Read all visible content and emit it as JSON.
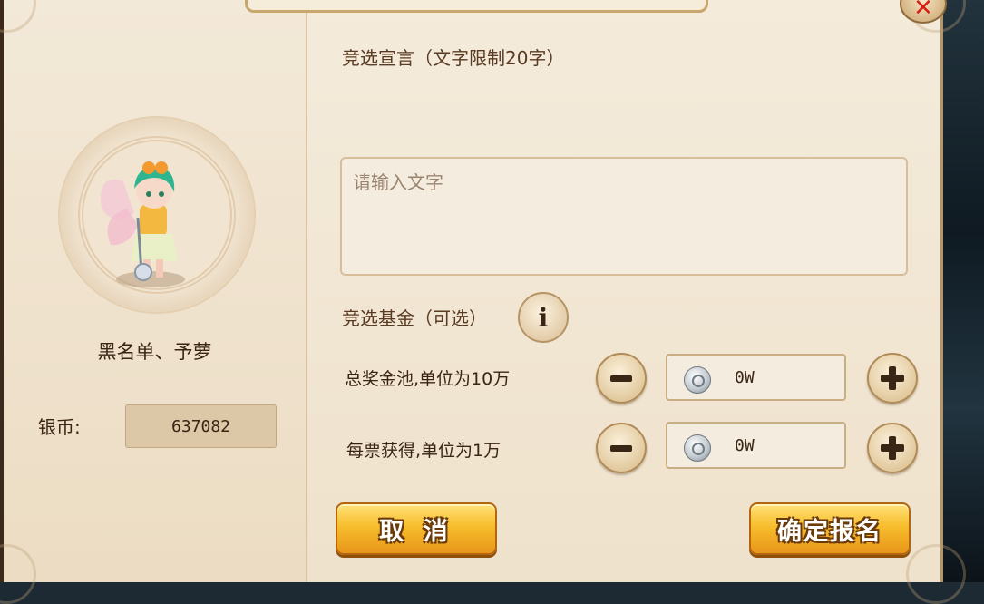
{
  "dialog": {
    "close_symbol": "✕",
    "close_icon": "close-icon"
  },
  "player": {
    "name": "黑名单、予萝",
    "avatar_icon": "fairy-character-portrait",
    "silver_label": "银币:",
    "silver_value": "637082"
  },
  "declaration": {
    "title": "竞选宣言（文字限制20字）",
    "placeholder": "请输入文字",
    "value": ""
  },
  "fund": {
    "title": "竞选基金（可选）",
    "info_icon_glyph": "i",
    "rows": [
      {
        "label": "总奖金池,单位为10万",
        "value": "0W"
      },
      {
        "label": "每票获得,单位为1万",
        "value": "0W"
      }
    ]
  },
  "actions": {
    "cancel_label": "取 消",
    "confirm_label": "确定报名"
  },
  "colors": {
    "panel": "#efe3cf",
    "gold_button": "#f7bd2c",
    "close_red": "#d61e14"
  }
}
